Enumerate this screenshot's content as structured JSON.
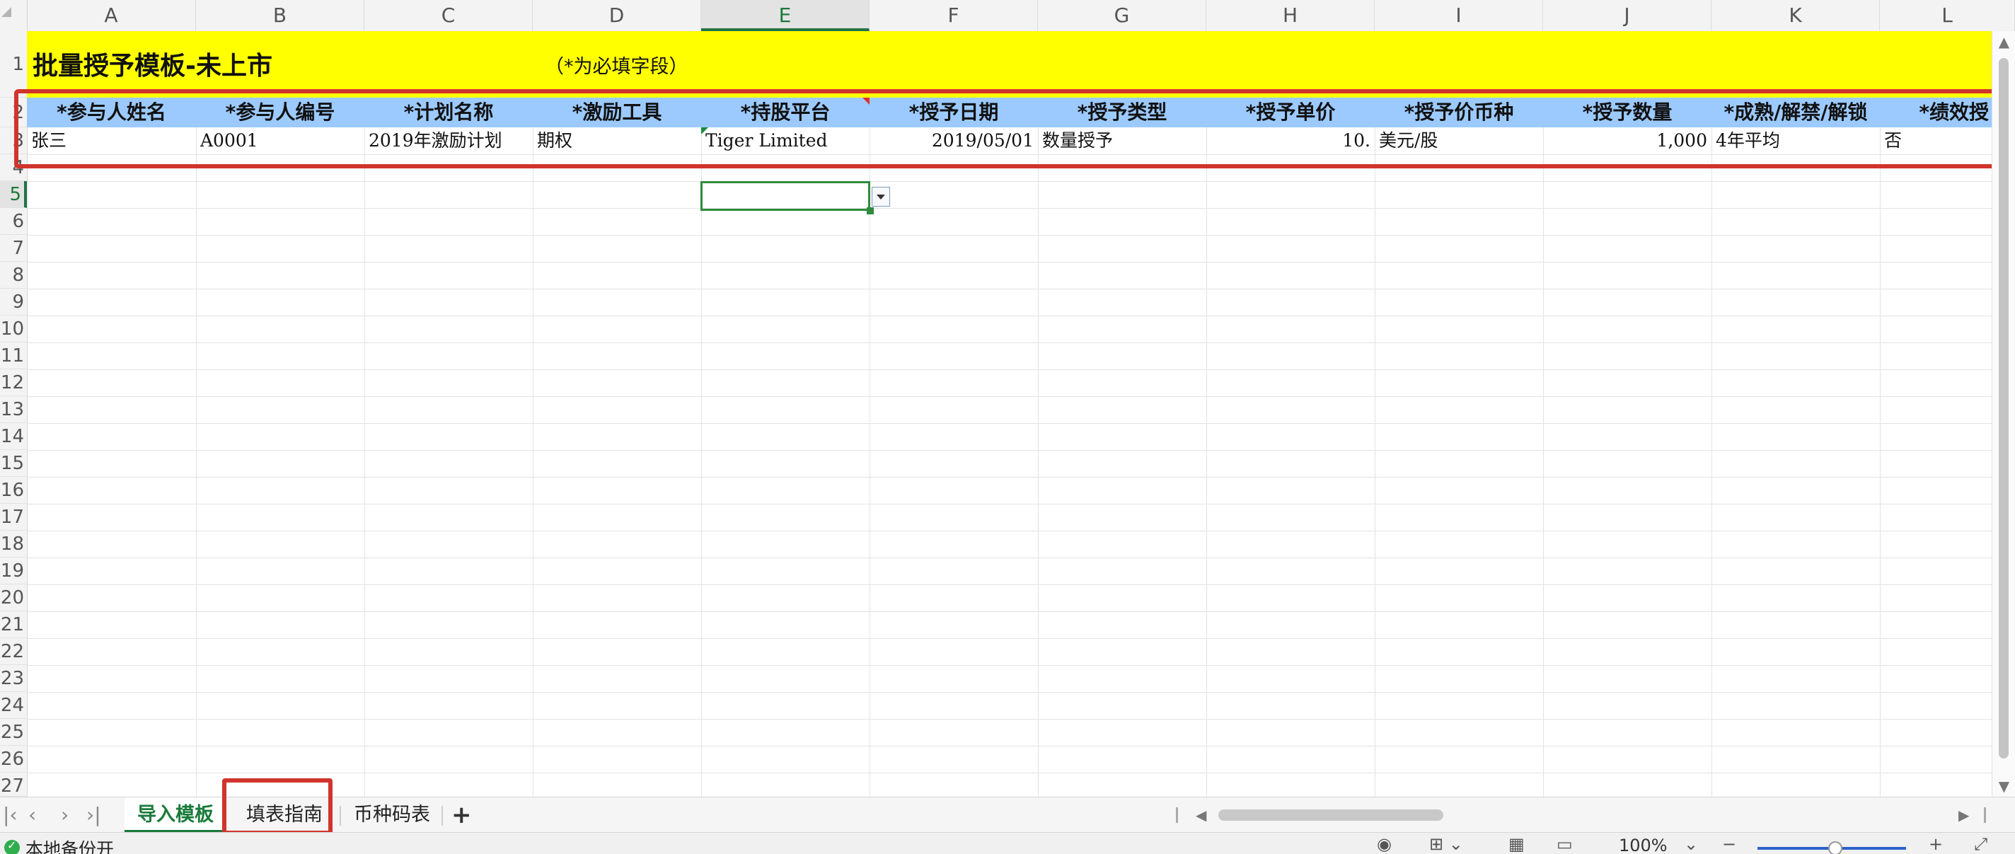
{
  "columns": [
    "A",
    "B",
    "C",
    "D",
    "E",
    "F",
    "G",
    "H",
    "I",
    "J",
    "K",
    "L"
  ],
  "active_column": "E",
  "rows": [
    "1",
    "2",
    "3",
    "4",
    "5",
    "6",
    "7",
    "8",
    "9",
    "10",
    "11",
    "12",
    "13",
    "14",
    "15",
    "16",
    "17",
    "18",
    "19",
    "20",
    "21",
    "22",
    "23",
    "24",
    "25",
    "26",
    "27"
  ],
  "active_row": "5",
  "sheet": {
    "title": "批量授予模板-未上市",
    "subtitle": "（*为必填字段）",
    "headers": [
      "*参与人姓名",
      "*参与人编号",
      "*计划名称",
      "*激励工具",
      "*持股平台",
      "*授予日期",
      "*授予类型",
      "*授予单价",
      "*授予价币种",
      "*授予数量",
      "*成熟/解禁/解锁",
      "*绩效授"
    ],
    "row3": [
      "张三",
      "A0001",
      "2019年激励计划",
      "期权",
      "Tiger Limited",
      "2019/05/01",
      "数量授予",
      "10.",
      "美元/股",
      "1,000",
      "4年平均",
      "否"
    ]
  },
  "tabs": {
    "items": [
      "导入模板",
      "填表指南",
      "币种码表"
    ],
    "active": "导入模板",
    "add_label": "+"
  },
  "status": {
    "backup_text": "本地备份开",
    "zoom": "100%",
    "zoom_minus": "−",
    "zoom_plus": "+"
  },
  "colors": {
    "title_fill": "#ffff00",
    "header_fill": "#9ccaff",
    "highlight": "#d0342c",
    "active_green": "#1a7a3a"
  },
  "icons": [
    "eye-icon",
    "grid-icon",
    "normal-view-icon",
    "page-layout-icon",
    "fullscreen-icon",
    "check-icon"
  ]
}
